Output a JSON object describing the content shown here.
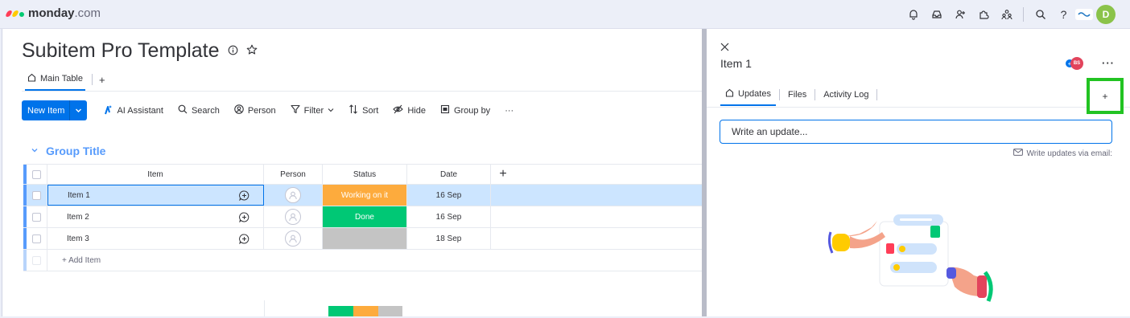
{
  "topbar": {
    "logo_text": "monday",
    "logo_suffix": ".com",
    "logo_colors": [
      "#ff3d57",
      "#ffcb00",
      "#00ca72"
    ],
    "icons": [
      "bell-icon",
      "inbox-icon",
      "invite-icon",
      "apps-icon",
      "team-icon",
      "search-icon",
      "help-icon"
    ],
    "help_label": "?",
    "avatar_initial": "D"
  },
  "board": {
    "title": "Subitem Pro Template",
    "view_tab": "Main Table",
    "add_view": "+",
    "toolbar": {
      "new_item": "New Item",
      "ai_assistant": "AI Assistant",
      "search": "Search",
      "person": "Person",
      "filter": "Filter",
      "sort": "Sort",
      "hide": "Hide",
      "group_by": "Group by",
      "more": "···"
    },
    "group_title": "Group Title",
    "group_color": "#579bfc",
    "columns": {
      "item": "Item",
      "person": "Person",
      "status": "Status",
      "date": "Date",
      "add": "+"
    },
    "rows": [
      {
        "name": "Item 1",
        "status": "Working on it",
        "status_color": "#fdab3d",
        "date": "16 Sep",
        "selected": true
      },
      {
        "name": "Item 2",
        "status": "Done",
        "status_color": "#00c875",
        "date": "16 Sep",
        "selected": false
      },
      {
        "name": "Item 3",
        "status": "",
        "status_color": "#c4c4c4",
        "date": "18 Sep",
        "selected": false
      }
    ],
    "add_item": "+ Add Item",
    "status_summary": [
      {
        "color": "#00c875",
        "share": 0.33
      },
      {
        "color": "#fdab3d",
        "share": 0.34
      },
      {
        "color": "#c4c4c4",
        "share": 0.33
      }
    ]
  },
  "panel": {
    "close": "✕",
    "title": "Item 1",
    "avatar_initials": "BS",
    "more": "···",
    "tabs": [
      "Updates",
      "Files",
      "Activity Log"
    ],
    "add_tab": "+",
    "input_placeholder": "Write an update...",
    "email_link": "Write updates via email:"
  }
}
